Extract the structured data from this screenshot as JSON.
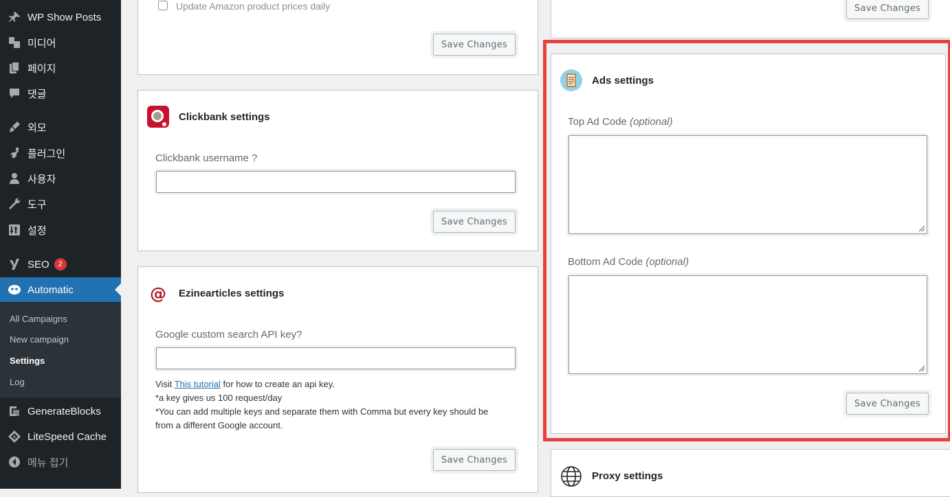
{
  "sidebar": {
    "items": [
      {
        "label": "WP Show Posts",
        "icon": "pin-icon"
      },
      {
        "label": "미디어",
        "icon": "media-icon"
      },
      {
        "label": "페이지",
        "icon": "pages-icon"
      },
      {
        "label": "댓글",
        "icon": "comments-icon"
      },
      {
        "label": "외모",
        "icon": "appearance-icon"
      },
      {
        "label": "플러그인",
        "icon": "plugins-icon"
      },
      {
        "label": "사용자",
        "icon": "users-icon"
      },
      {
        "label": "도구",
        "icon": "tools-icon"
      },
      {
        "label": "설정",
        "icon": "settings-icon"
      },
      {
        "label": "SEO",
        "icon": "yoast-icon",
        "badge": "2"
      },
      {
        "label": "Automatic",
        "icon": "automatic-icon"
      },
      {
        "label": "GenerateBlocks",
        "icon": "generateblocks-icon"
      },
      {
        "label": "LiteSpeed Cache",
        "icon": "litespeed-icon"
      },
      {
        "label": "메뉴 접기",
        "icon": "collapse-icon"
      }
    ],
    "submenu": [
      "All Campaigns",
      "New campaign",
      "Settings",
      "Log"
    ]
  },
  "amazon": {
    "checkbox_label": "Update Amazon product prices daily",
    "save_label": "Save Changes"
  },
  "clickbank": {
    "title": "Clickbank settings",
    "username_label": "Clickbank username ?",
    "save_label": "Save Changes"
  },
  "ezine": {
    "title": "Ezinearticles settings",
    "api_label": "Google custom search API key?",
    "help_visit": "Visit ",
    "help_link": "This tutorial",
    "help_rest": " for how to create an api key.",
    "help_line2": "*a key gives us 100 request/day",
    "help_line3": "*You can add multiple keys and separate them with Comma but every key should be",
    "help_line4": "from a different Google account.",
    "save_label": "Save Changes"
  },
  "top_right": {
    "save_label": "Save Changes"
  },
  "ads": {
    "title": "Ads settings",
    "top_label": "Top Ad Code",
    "bottom_label": "Bottom Ad Code",
    "optional": "(optional)",
    "save_label": "Save Changes"
  },
  "proxy": {
    "title": "Proxy settings"
  },
  "colors": {
    "highlight": "#e8403f",
    "accent": "#2271b1"
  }
}
